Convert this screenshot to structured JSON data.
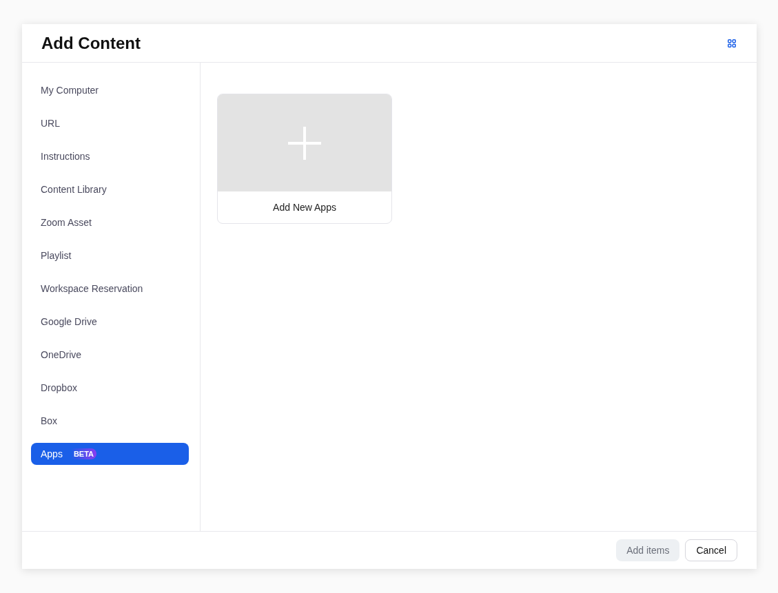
{
  "window": {
    "title": "Add Content"
  },
  "sidebar": {
    "items": [
      {
        "label": "My Computer",
        "selected": false
      },
      {
        "label": "URL",
        "selected": false
      },
      {
        "label": "Instructions",
        "selected": false
      },
      {
        "label": "Content Library",
        "selected": false
      },
      {
        "label": "Zoom Asset",
        "selected": false
      },
      {
        "label": "Playlist",
        "selected": false
      },
      {
        "label": "Workspace Reservation",
        "selected": false
      },
      {
        "label": "Google Drive",
        "selected": false
      },
      {
        "label": "OneDrive",
        "selected": false
      },
      {
        "label": "Dropbox",
        "selected": false
      },
      {
        "label": "Box",
        "selected": false
      },
      {
        "label": "Apps",
        "selected": true,
        "badge": "BETA"
      }
    ]
  },
  "cards": [
    {
      "label": "Add New Apps"
    }
  ],
  "footer": {
    "buttons": [
      {
        "label": "Add items",
        "kind": "primary",
        "disabled": true
      },
      {
        "label": "Cancel",
        "kind": "secondary",
        "disabled": false
      }
    ]
  }
}
